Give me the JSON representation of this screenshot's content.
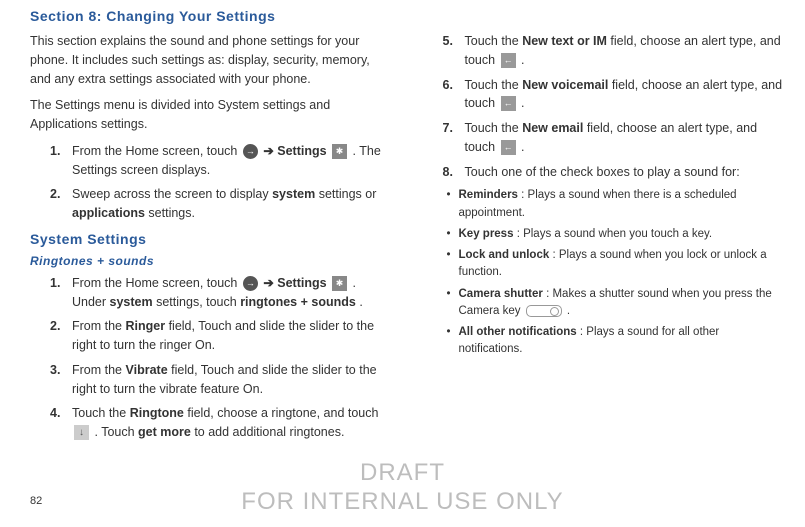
{
  "section_title": "Section 8: Changing Your Settings",
  "page_number": "82",
  "watermark_line1": "DRAFT",
  "watermark_line2": "FOR INTERNAL USE ONLY",
  "left": {
    "intro1": "This section explains the sound and phone settings for your phone. It includes such settings as: display, security, memory, and any extra settings associated with your phone.",
    "intro2": "The Settings menu is divided into System settings and Applications settings.",
    "step1_a": "From the Home screen, touch ",
    "step1_b": " ➔ ",
    "step1_settings": "Settings",
    "step1_c": " . The Settings screen displays.",
    "step2_a": "Sweep across the screen to display ",
    "step2_system": "system",
    "step2_b": " settings or ",
    "step2_apps": "applications",
    "step2_c": " settings.",
    "sys_heading": "System Settings",
    "ring_heading": "Ringtones + sounds",
    "r1_a": "From the Home screen, touch ",
    "r1_b": " ➔ ",
    "r1_settings": "Settings",
    "r1_c": " . Under ",
    "r1_system": "system",
    "r1_d": " settings, touch ",
    "r1_ringtones": "ringtones + sounds",
    "r1_e": ".",
    "r2_a": "From the ",
    "r2_ringer": "Ringer",
    "r2_b": " field, Touch and slide the slider to the right to turn the ringer On.",
    "r3_a": "From the ",
    "r3_vibrate": "Vibrate",
    "r3_b": " field, Touch and slide the slider to the right to turn the vibrate feature On.",
    "r4_a": "Touch the ",
    "r4_ringtone": "Ringtone",
    "r4_b": " field, choose a ringtone, and touch ",
    "r4_c": ". Touch ",
    "r4_getmore": "get more",
    "r4_d": " to add additional ringtones."
  },
  "right": {
    "r5_a": "Touch the ",
    "r5_newtext": "New text or IM",
    "r5_b": " field, choose an alert type, and touch ",
    "r5_c": " .",
    "r6_a": "Touch the ",
    "r6_newvoice": "New voicemail",
    "r6_b": " field, choose an alert type, and touch ",
    "r6_c": " .",
    "r7_a": "Touch the ",
    "r7_newemail": "New email",
    "r7_b": " field, choose an alert type, and touch ",
    "r7_c": ".",
    "r8": "Touch one of the check boxes to play a sound for:",
    "b1_label": "Reminders",
    "b1_text": ": Plays a sound when there is a scheduled appointment.",
    "b2_label": "Key press",
    "b2_text": ": Plays a sound when you touch a key.",
    "b3_label": "Lock and unlock",
    "b3_text": ": Plays a sound when you lock or unlock a function.",
    "b4_label": "Camera shutter",
    "b4_text_a": ": Makes a shutter sound when you press the Camera key ",
    "b4_text_b": " .",
    "b5_label": "All other notifications",
    "b5_text": ": Plays a sound for all other notifications."
  }
}
